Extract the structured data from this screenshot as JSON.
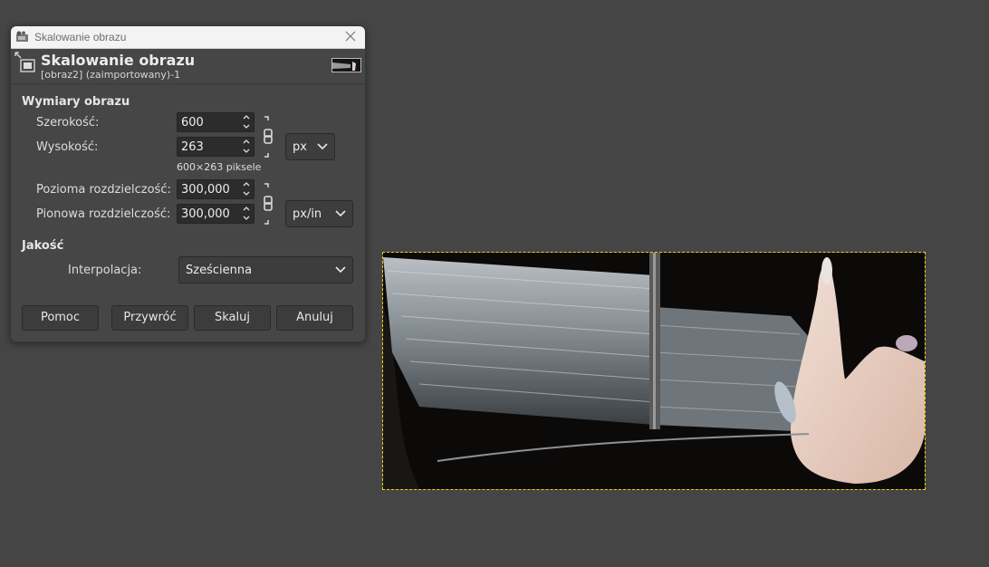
{
  "window": {
    "title": "Skalowanie obrazu"
  },
  "header": {
    "title": "Skalowanie obrazu",
    "subtitle": "[obraz2] (zaimportowany)-1"
  },
  "image_size": {
    "section_label": "Wymiary obrazu",
    "width_label": "Szerokość:",
    "width_value": "600",
    "height_label": "Wysokość:",
    "height_value": "263",
    "size_note": "600×263 piksele",
    "unit": "px",
    "xres_label": "Pozioma rozdzielczość:",
    "xres_value": "300,000",
    "yres_label": "Pionowa rozdzielczość:",
    "yres_value": "300,000",
    "res_unit": "px/in"
  },
  "quality": {
    "section_label": "Jakość",
    "interp_label": "Interpolacja:",
    "interp_value": "Sześcienna"
  },
  "buttons": {
    "help": "Pomoc",
    "reset": "Przywróć",
    "scale": "Skaluj",
    "cancel": "Anuluj"
  },
  "colors": {
    "canvas_bg": "#454545",
    "dialog_bg": "#464646",
    "selection": "#e6d400"
  },
  "icons": [
    "gimp-app-icon",
    "close-icon",
    "scale-image-icon",
    "chain-link-icon",
    "chevron-down-icon",
    "spin-up-icon",
    "spin-down-icon"
  ]
}
